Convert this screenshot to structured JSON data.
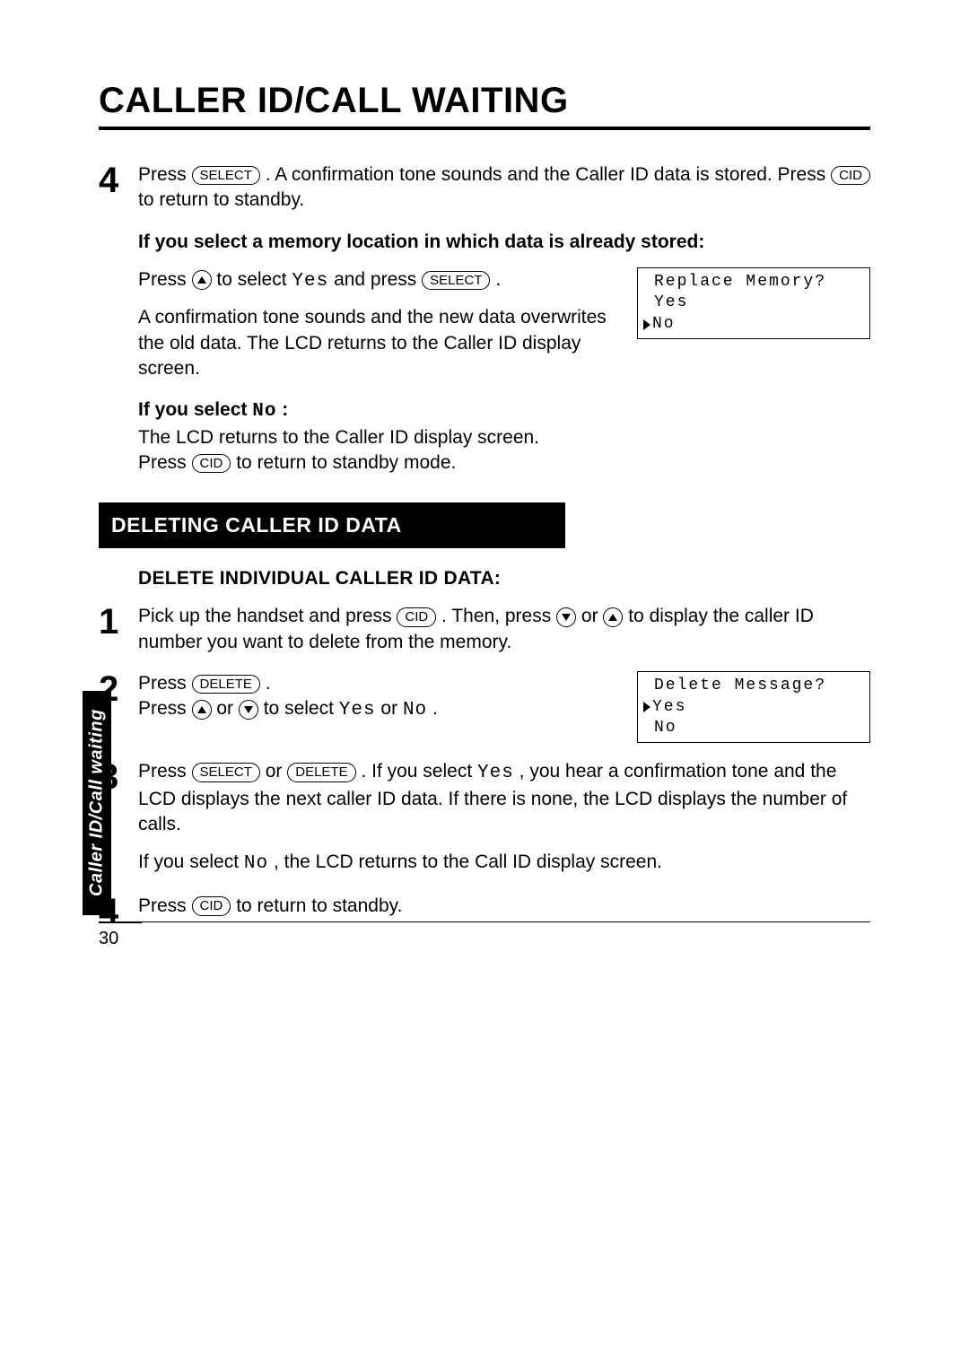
{
  "title": "CALLER ID/CALL WAITING",
  "sidebar_tab": "Caller ID/Call waiting",
  "page_number": "30",
  "buttons": {
    "select": "SELECT",
    "cid": "CID",
    "delete": "DELETE"
  },
  "mono": {
    "yes": "Yes",
    "no": "No"
  },
  "top_step4": {
    "num": "4",
    "line1_a": "Press ",
    "line1_b": ". A confirmation tone sounds and the Caller ID data is stored. Press ",
    "line1_c": " to return to standby."
  },
  "mem_heading": "If you select a memory location in which data is already stored:",
  "mem_line1_a": "Press ",
  "mem_line1_b": " to select ",
  "mem_line1_c": " and press ",
  "mem_line1_d": ".",
  "mem_line2": "A confirmation tone sounds and the new data overwrites the old data. The LCD returns to the Caller ID display screen.",
  "lcd1": {
    "line1": "Replace Memory?",
    "line2": "Yes",
    "line3": "No"
  },
  "ifno_heading_a": "If you select ",
  "ifno_heading_b": " :",
  "ifno_line1": "The LCD returns to the Caller ID display screen.",
  "ifno_line2_a": "Press ",
  "ifno_line2_b": " to return to standby mode.",
  "section_bar": "DELETING CALLER ID DATA",
  "subheading": "DELETE INDIVIDUAL CALLER ID DATA:",
  "d_step1": {
    "num": "1",
    "a": "Pick up the handset and press ",
    "b": ". Then, press ",
    "c": " or ",
    "d": " to display the caller ID number you want to delete from the memory."
  },
  "d_step2": {
    "num": "2",
    "a": "Press ",
    "b": ".",
    "c": "Press ",
    "d": " or ",
    "e": " to select ",
    "f": " or ",
    "g": "."
  },
  "lcd2": {
    "line1": "Delete Message?",
    "line2": "Yes",
    "line3": "No"
  },
  "d_step3": {
    "num": "3",
    "a": "Press ",
    "b": " or ",
    "c": ".  If you select ",
    "d": " , you hear a confirmation tone and the LCD displays the next caller ID data. If there is none, the LCD displays the number of calls.",
    "e": "If you select ",
    "f": " , the LCD returns to the Call ID display screen."
  },
  "d_step4": {
    "num": "4",
    "a": "Press ",
    "b": " to return to standby."
  }
}
